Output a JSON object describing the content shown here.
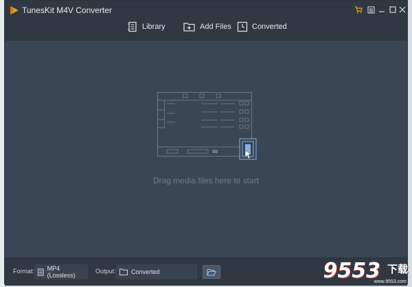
{
  "window": {
    "title": "TunesKit M4V Converter"
  },
  "toolbar": {
    "library_label": "Library",
    "add_files_label": "Add Files",
    "converted_label": "Converted"
  },
  "dropzone": {
    "hint": "Drag media files here to start"
  },
  "footer": {
    "format_label": "Format:",
    "format_value": "MP4 (Lossless)",
    "output_label": "Output:",
    "output_value": "Converted"
  },
  "watermark": {
    "number": "9553",
    "chinese": "下载",
    "url": "www.9553.com"
  },
  "colors": {
    "titlebar": "#303943",
    "content_bg": "#3b4654",
    "accent_cart": "#f0a020",
    "drop_hint": "#6f7c8b"
  }
}
